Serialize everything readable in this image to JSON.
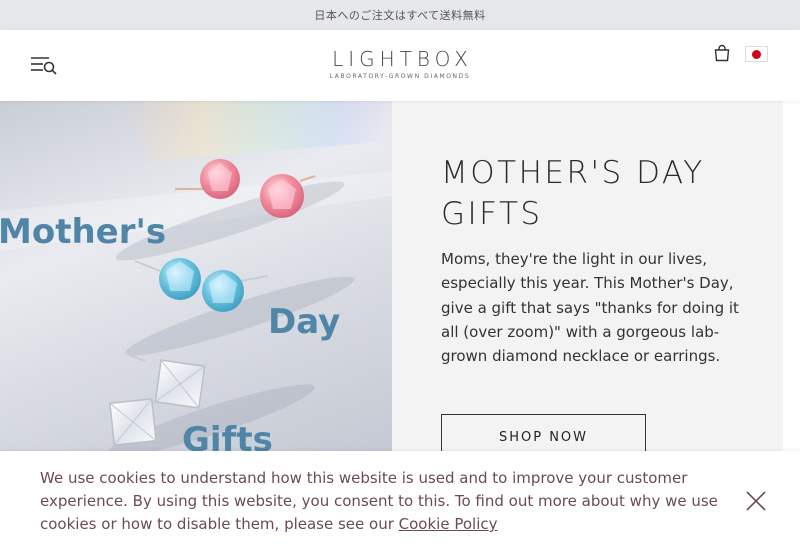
{
  "promo_bar": {
    "text": "日本へのご注文はすべて送料無料"
  },
  "header": {
    "menu_icon": "menu-search-icon",
    "logo": {
      "wordmark": "LIGHTBOX",
      "tagline": "LABORATORY-GROWN DIAMONDS"
    },
    "cart_icon": "shopping-bag-icon",
    "region_flag": "japan-flag-icon"
  },
  "hero": {
    "image_text": {
      "line1": "Mother's",
      "line2": "Day",
      "line3": "Gifts"
    },
    "title": "MOTHER'S DAY GIFTS",
    "body": "Moms, they're the light in our lives, especially this year. This Mother's Day, give a gift that says \"thanks for doing it all (over zoom)\" with a gorgeous lab-grown diamond necklace or earrings.",
    "cta_label": "SHOP NOW"
  },
  "cookie_banner": {
    "text": "We use cookies to understand how this website is used and to improve your customer experience. By using this website, you consent to this. To find out more about why we use cookies or how to disable them, please see our ",
    "link_label": "Cookie Policy",
    "close_icon": "close-icon"
  },
  "colors": {
    "promo_bg": "#e6e7ea",
    "hero_panel_bg": "#f3f3f3",
    "image_text": "#4f86a8",
    "cookie_text": "#6b4a58",
    "pink_stone": "#f08fa0",
    "blue_stone": "#6cc4e0"
  }
}
